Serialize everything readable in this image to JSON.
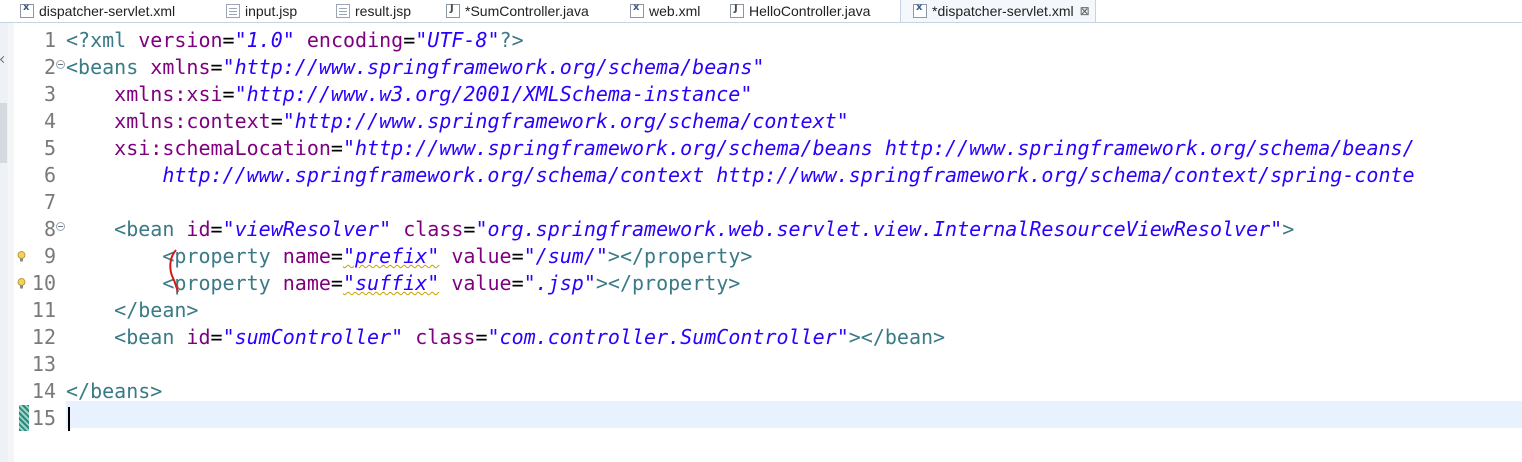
{
  "tabs": [
    {
      "label": "dispatcher-servlet.xml",
      "icon": "xml-file-icon"
    },
    {
      "label": "input.jsp",
      "icon": "jsp-file-icon"
    },
    {
      "label": "result.jsp",
      "icon": "jsp-file-icon"
    },
    {
      "label": "*SumController.java",
      "icon": "java-file-icon"
    },
    {
      "label": "web.xml",
      "icon": "xml-file-icon"
    },
    {
      "label": "HelloController.java",
      "icon": "java-file-icon"
    },
    {
      "label": "*dispatcher-servlet.xml",
      "icon": "xml-file-icon",
      "active": true,
      "close": "⊠"
    }
  ],
  "editor": {
    "line_numbers": [
      "1",
      "2",
      "3",
      "4",
      "5",
      "6",
      "7",
      "8",
      "9",
      "10",
      "11",
      "12",
      "13",
      "14",
      "15"
    ],
    "lines": [
      {
        "segments": [
          [
            "tag",
            "<?xml "
          ],
          [
            "attr",
            "version"
          ],
          [
            "plain",
            "="
          ],
          [
            "val",
            "\"1.0\""
          ],
          [
            "plain",
            " "
          ],
          [
            "attr",
            "encoding"
          ],
          [
            "plain",
            "="
          ],
          [
            "val",
            "\"UTF-8\""
          ],
          [
            "tag",
            "?>"
          ]
        ]
      },
      {
        "segments": [
          [
            "tag",
            "<beans "
          ],
          [
            "attr",
            "xmlns"
          ],
          [
            "plain",
            "="
          ],
          [
            "val",
            "\"http://www.springframework.org/schema/beans\""
          ]
        ]
      },
      {
        "segments": [
          [
            "plain",
            "    "
          ],
          [
            "attr",
            "xmlns:xsi"
          ],
          [
            "plain",
            "="
          ],
          [
            "val",
            "\"http://www.w3.org/2001/XMLSchema-instance\""
          ]
        ]
      },
      {
        "segments": [
          [
            "plain",
            "    "
          ],
          [
            "attr",
            "xmlns:context"
          ],
          [
            "plain",
            "="
          ],
          [
            "val",
            "\"http://www.springframework.org/schema/context\""
          ]
        ]
      },
      {
        "segments": [
          [
            "plain",
            "    "
          ],
          [
            "attr",
            "xsi:schemaLocation"
          ],
          [
            "plain",
            "="
          ],
          [
            "val",
            "\"http://www.springframework.org/schema/beans http://www.springframework.org/schema/beans/"
          ]
        ]
      },
      {
        "segments": [
          [
            "plain",
            "        "
          ],
          [
            "val",
            "http://www.springframework.org/schema/context http://www.springframework.org/schema/context/spring-conte"
          ]
        ]
      },
      {
        "segments": []
      },
      {
        "segments": [
          [
            "plain",
            "    "
          ],
          [
            "tag",
            "<bean "
          ],
          [
            "attr",
            "id"
          ],
          [
            "plain",
            "="
          ],
          [
            "val",
            "\"viewResolver\""
          ],
          [
            "plain",
            " "
          ],
          [
            "attr",
            "class"
          ],
          [
            "plain",
            "="
          ],
          [
            "val",
            "\"org.springframework.web.servlet.view.InternalResourceViewResolver\""
          ],
          [
            "tag",
            ">"
          ]
        ]
      },
      {
        "segments": [
          [
            "plain",
            "        "
          ],
          [
            "tag",
            "<property "
          ],
          [
            "attr",
            "name"
          ],
          [
            "plain",
            "="
          ],
          [
            "valw",
            "\"prefix\""
          ],
          [
            "plain",
            " "
          ],
          [
            "attr",
            "value"
          ],
          [
            "plain",
            "="
          ],
          [
            "val",
            "\"/sum/\""
          ],
          [
            "tag",
            "></property>"
          ]
        ]
      },
      {
        "segments": [
          [
            "plain",
            "        "
          ],
          [
            "tag",
            "<property "
          ],
          [
            "attr",
            "name"
          ],
          [
            "plain",
            "="
          ],
          [
            "valw",
            "\"suffix\""
          ],
          [
            "plain",
            " "
          ],
          [
            "attr",
            "value"
          ],
          [
            "plain",
            "="
          ],
          [
            "val",
            "\".jsp\""
          ],
          [
            "tag",
            "></property>"
          ]
        ]
      },
      {
        "segments": [
          [
            "plain",
            "    "
          ],
          [
            "tag",
            "</bean>"
          ]
        ]
      },
      {
        "segments": [
          [
            "plain",
            "    "
          ],
          [
            "tag",
            "<bean "
          ],
          [
            "attr",
            "id"
          ],
          [
            "plain",
            "="
          ],
          [
            "val",
            "\"sumController\""
          ],
          [
            "plain",
            " "
          ],
          [
            "attr",
            "class"
          ],
          [
            "plain",
            "="
          ],
          [
            "val",
            "\"com.controller.SumController\""
          ],
          [
            "tag",
            "></bean>"
          ]
        ]
      },
      {
        "segments": []
      },
      {
        "segments": [
          [
            "tag",
            "</beans>"
          ]
        ]
      },
      {
        "segments": []
      }
    ]
  },
  "colors": {
    "tag": "#3a7a86",
    "attr": "#7f007f",
    "value": "#2a00ff",
    "current_line": "#e8f2fe"
  }
}
